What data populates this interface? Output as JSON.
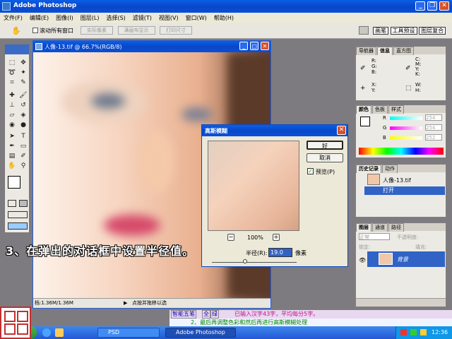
{
  "app": {
    "title": "Adobe Photoshop"
  },
  "menu": [
    "文件(F)",
    "编辑(E)",
    "图像(I)",
    "图层(L)",
    "选择(S)",
    "滤镜(T)",
    "视图(V)",
    "窗口(W)",
    "帮助(H)"
  ],
  "options": {
    "scroll_all": "滚动所有窗口",
    "actual_pixels": "实际像素",
    "fit_screen": "满画布显示",
    "print_size": "打印尺寸"
  },
  "right_tabs": [
    "画笔",
    "工具预设",
    "图层复合"
  ],
  "doc": {
    "title": "人像-13.tif @ 66.7%(RGB/8)",
    "status": "档:1.36M/1.36M",
    "hint": "点按并拖移以选"
  },
  "dialog": {
    "title": "高斯模糊",
    "ok": "好",
    "cancel": "取消",
    "preview_label": "预览(P)",
    "preview_checked": true,
    "zoom": "100%",
    "minus": "−",
    "plus": "+",
    "radius_label": "半径(R):",
    "radius_value": "19.0",
    "radius_unit": "像素"
  },
  "caption": "3、在弹出的对话框中设置半径值。",
  "navigator": {
    "tabs": [
      "导航器",
      "信息",
      "直方图"
    ],
    "labels": {
      "r": "R:",
      "g": "G:",
      "b": "B:",
      "c": "C:",
      "m": "M:",
      "y": "Y:",
      "k": "K:",
      "x": "X:",
      "yy": "Y:",
      "w": "W:",
      "h": "H:"
    }
  },
  "color": {
    "tabs": [
      "颜色",
      "色板",
      "样式"
    ],
    "r": "R",
    "g": "G",
    "b": "B",
    "rv": "254",
    "gv": "254",
    "bv": "252"
  },
  "history": {
    "tabs": [
      "历史记录",
      "动作"
    ],
    "snapshot": "人像-13.tif",
    "item": "打开"
  },
  "layers": {
    "tabs": [
      "图层",
      "通道",
      "路径"
    ],
    "blend": "正常",
    "opacity_label": "不透明度:",
    "lock_label": "锁定:",
    "fill_label": "填充:",
    "layer_name": "背景"
  },
  "ime": {
    "mode": "智能五笔",
    "full": "全",
    "extra": "绿",
    "status": "已输入汉字43字，平均每分5字。",
    "hint": "2、最后再调整色彩和然后再进行高斯模糊处理"
  },
  "taskbar": {
    "start": "开始",
    "task1": "PSD",
    "task2": "Adobe Photoshop",
    "time": "12:36"
  },
  "colors": {
    "xp_blue": "#0a4fd8",
    "selection": "#3163c6"
  }
}
